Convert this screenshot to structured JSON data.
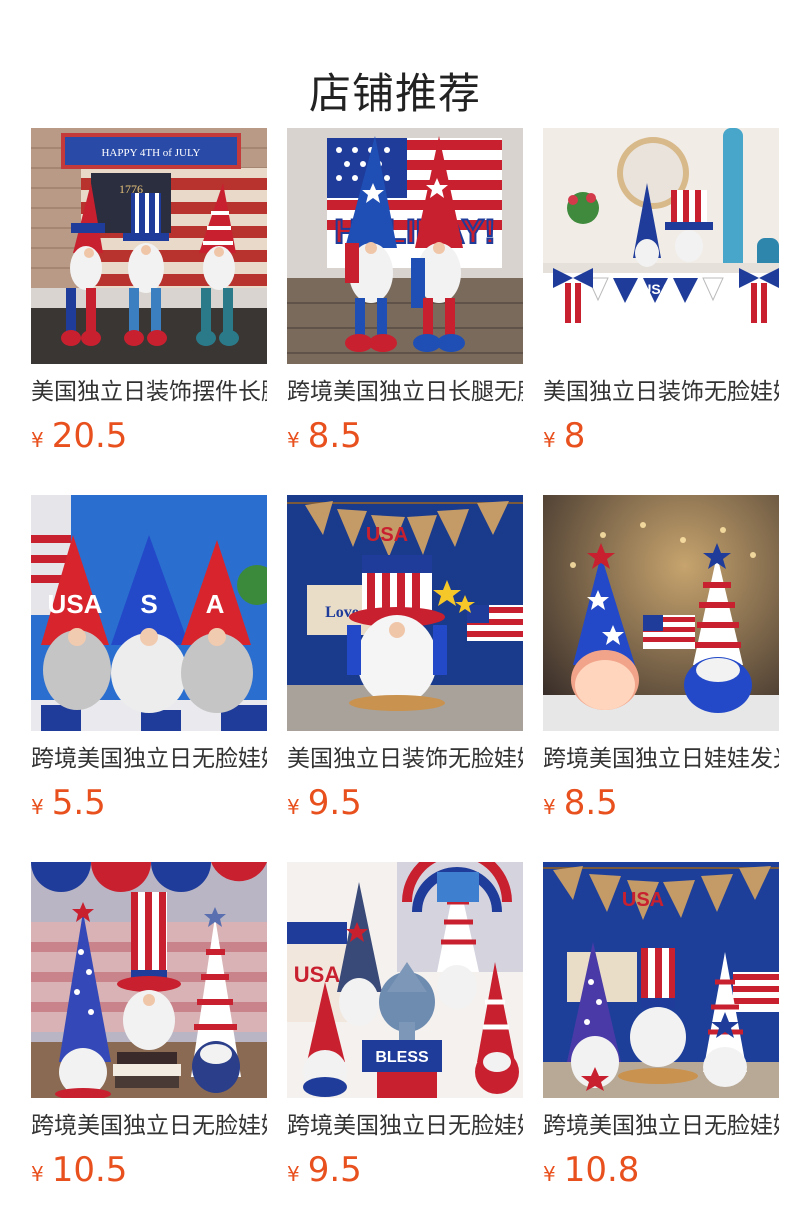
{
  "section": {
    "title": "店铺推荐"
  },
  "products": [
    {
      "name": "美国独立日装饰摆件长腿无脸侏儒娃娃",
      "currency": "¥",
      "price": "20.5",
      "banner_text": "HAPPY 4TH of JULY",
      "sign_text": "1776"
    },
    {
      "name": "跨境美国独立日长腿无脸娃娃装饰",
      "currency": "¥",
      "price": "8.5",
      "banner_text": "HOLIDAY!"
    },
    {
      "name": "美国独立日装饰无脸娃娃摆件",
      "currency": "¥",
      "price": "8",
      "banner_text": "USA"
    },
    {
      "name": "跨境美国独立日无脸娃娃摆件",
      "currency": "¥",
      "price": "5.5",
      "banner_text": "USA"
    },
    {
      "name": "美国独立日装饰无脸娃娃摆件",
      "currency": "¥",
      "price": "9.5",
      "banner_text": "USA",
      "sign_text": "Love"
    },
    {
      "name": "跨境美国独立日娃娃发光摆件",
      "currency": "¥",
      "price": "8.5"
    },
    {
      "name": "跨境美国独立日无脸娃娃摆件",
      "currency": "¥",
      "price": "10.5"
    },
    {
      "name": "跨境美国独立日无脸娃娃摆件",
      "currency": "¥",
      "price": "9.5",
      "banner_text": "BLESS",
      "sign_text": "USA"
    },
    {
      "name": "跨境美国独立日无脸娃娃摆件",
      "currency": "¥",
      "price": "10.8",
      "banner_text": "USA"
    }
  ],
  "colors": {
    "price": "#e8501e",
    "title": "#222222",
    "name": "#333333",
    "flag_red": "#c8202f",
    "flag_blue": "#1f3c9a"
  }
}
